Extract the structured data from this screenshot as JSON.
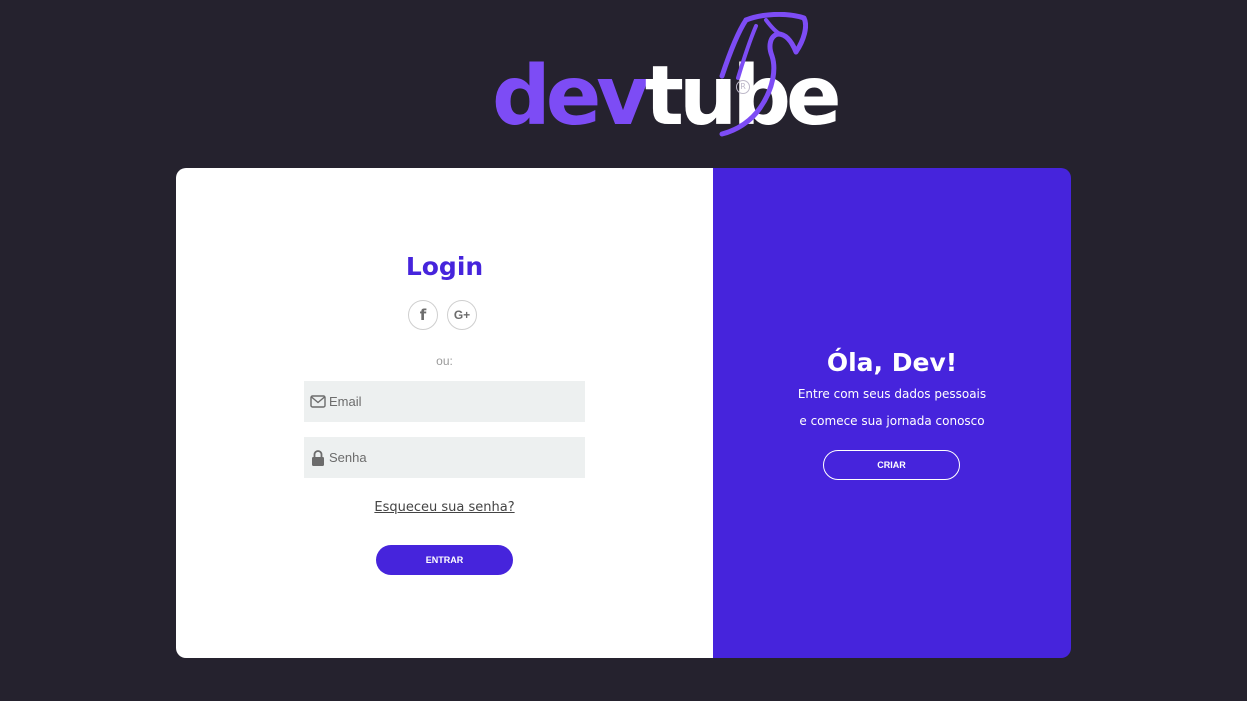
{
  "brand": {
    "logo_part1": "dev",
    "logo_part2": "tube",
    "registered_mark": "R",
    "colors": {
      "primary": "#4624dc",
      "logo_accent": "#7d4cf5",
      "background": "#25222e"
    }
  },
  "login": {
    "title": "Login",
    "social": [
      {
        "icon": "facebook-icon",
        "label": "f"
      },
      {
        "icon": "google-plus-icon",
        "label": "G+"
      }
    ],
    "divider_text": "ou:",
    "email_placeholder": "Email",
    "password_placeholder": "Senha",
    "forgot_link": "Esqueceu sua senha?",
    "submit_label": "ENTRAR"
  },
  "signup": {
    "title": "Óla, Dev!",
    "line1": "Entre com seus dados pessoais",
    "line2": "e comece sua jornada conosco",
    "button_label": "CRIAR"
  }
}
